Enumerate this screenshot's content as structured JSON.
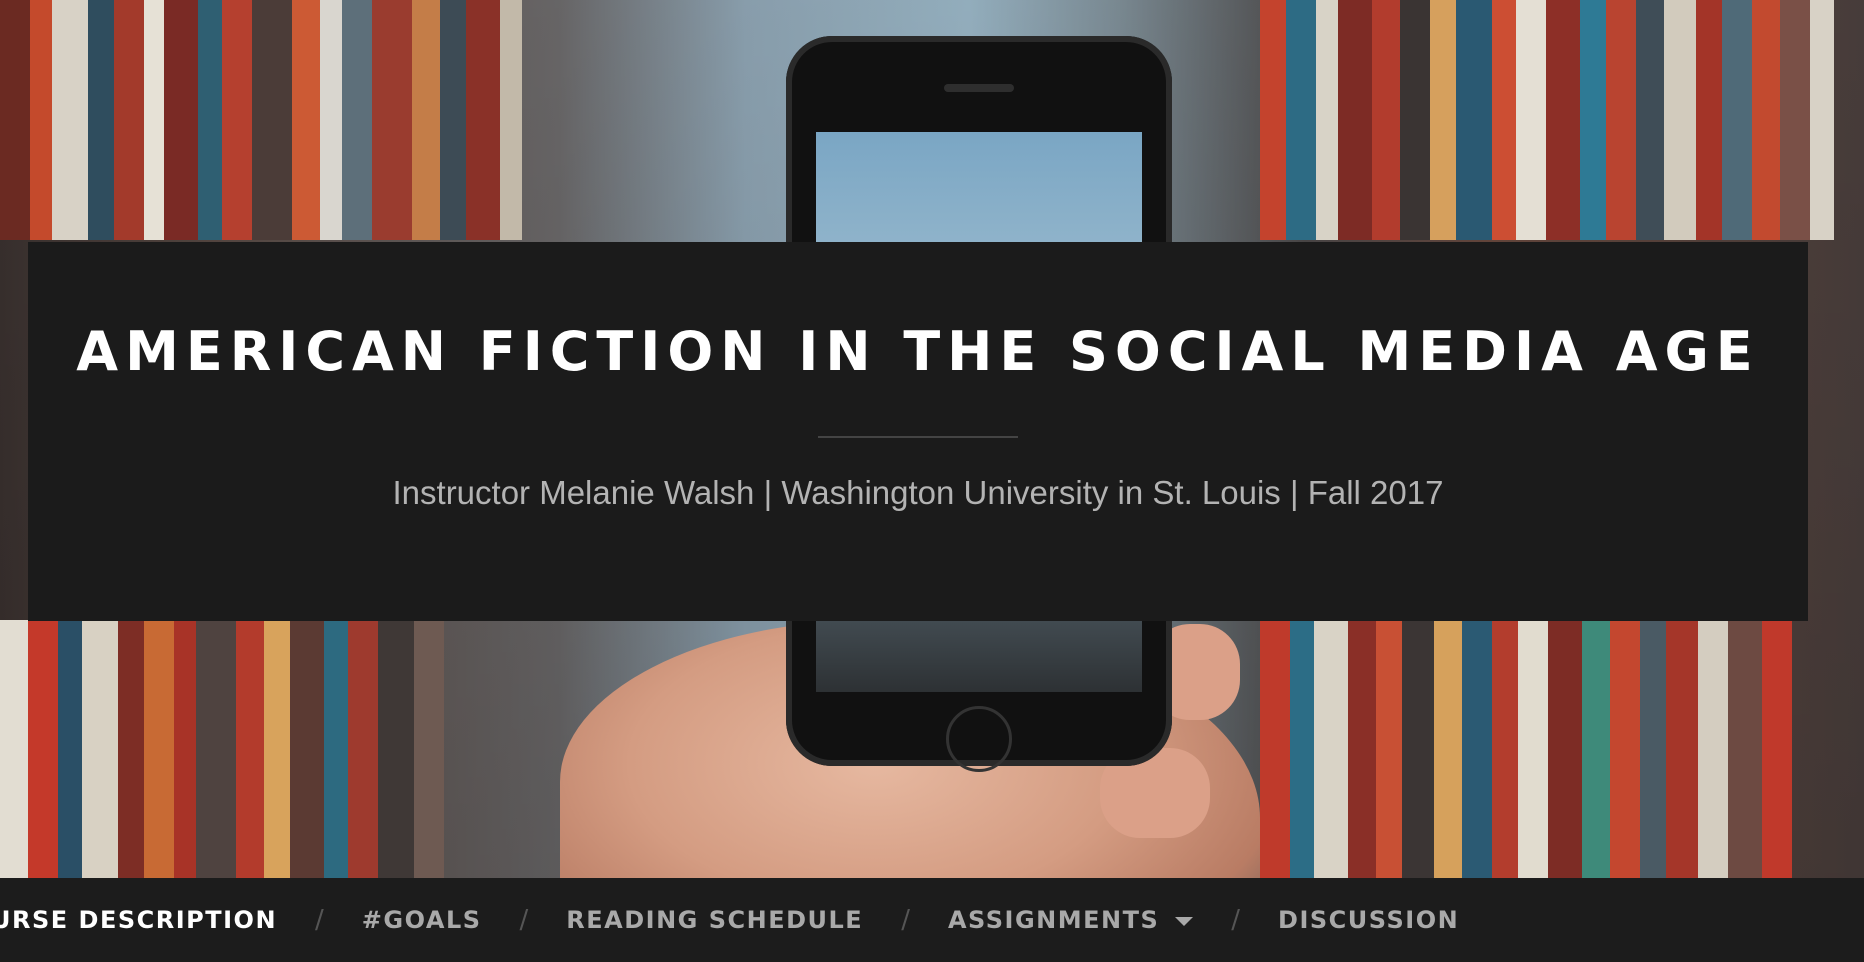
{
  "header": {
    "title": "AMERICAN FICTION IN THE SOCIAL MEDIA AGE",
    "description": "Instructor Melanie Walsh | Washington University in St. Louis | Fall 2017"
  },
  "nav": {
    "items": [
      {
        "label": "COURSE DESCRIPTION",
        "active": true
      },
      {
        "label": "#GOALS"
      },
      {
        "label": "READING SCHEDULE"
      },
      {
        "label": "ASSIGNMENTS",
        "has_dropdown": true
      },
      {
        "label": "DISCUSSION"
      }
    ],
    "separator": "/"
  },
  "colors": {
    "title_box_bg": "#1b1b1b",
    "nav_bg": "#1c1c1c",
    "nav_text": "#a9a9a9",
    "nav_active_text": "#ffffff"
  }
}
